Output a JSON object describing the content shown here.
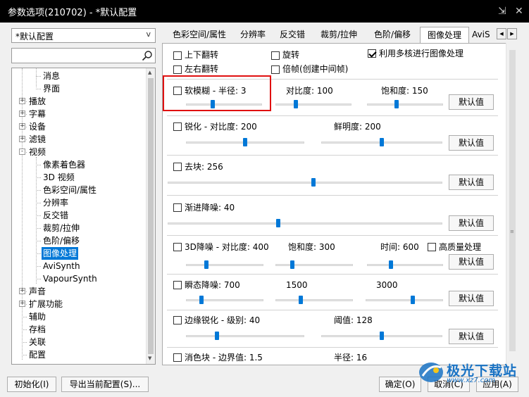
{
  "window": {
    "title": "参数选项(210702) - *默认配置",
    "pin_icon": "pin-icon",
    "close_icon": "close-icon"
  },
  "sidebar": {
    "profile_combo": "*默认配置",
    "search": {
      "value": "",
      "placeholder": ""
    },
    "tree_items": [
      {
        "label": "消息",
        "level": 2
      },
      {
        "label": "界面",
        "level": 2
      },
      {
        "label": "播放",
        "level": 1,
        "expander": "+"
      },
      {
        "label": "字幕",
        "level": 1,
        "expander": "+"
      },
      {
        "label": "设备",
        "level": 1,
        "expander": "+"
      },
      {
        "label": "滤镜",
        "level": 1,
        "expander": "+"
      },
      {
        "label": "视频",
        "level": 1,
        "expander": "-"
      },
      {
        "label": "像素着色器",
        "level": 2
      },
      {
        "label": "3D 视频",
        "level": 2
      },
      {
        "label": "色彩空间/属性",
        "level": 2
      },
      {
        "label": "分辨率",
        "level": 2
      },
      {
        "label": "反交错",
        "level": 2
      },
      {
        "label": "裁剪/拉伸",
        "level": 2
      },
      {
        "label": "色阶/偏移",
        "level": 2
      },
      {
        "label": "图像处理",
        "level": 2,
        "selected": true
      },
      {
        "label": "AviSynth",
        "level": 2
      },
      {
        "label": "VapourSynth",
        "level": 2
      },
      {
        "label": "声音",
        "level": 1,
        "expander": "+"
      },
      {
        "label": "扩展功能",
        "level": 1,
        "expander": "+"
      },
      {
        "label": "辅助",
        "level": 1
      },
      {
        "label": "存档",
        "level": 1
      },
      {
        "label": "关联",
        "level": 1
      },
      {
        "label": "配置",
        "level": 1
      }
    ]
  },
  "tabs": [
    "色彩空间/属性",
    "分辨率",
    "反交错",
    "裁剪/拉伸",
    "色阶/偏移",
    "图像处理",
    "AviS"
  ],
  "active_tab": "图像处理",
  "options": {
    "flip_v": "上下翻转",
    "flip_h": "左右翻转",
    "rotate": "旋转",
    "double_frame": "倍帧(创建中间帧)",
    "multicore": "利用多核进行图像处理",
    "multicore_checked": true
  },
  "sections": {
    "soft_blur": {
      "label": "软模糊 - 半径: 3",
      "contrast": "对比度: 100",
      "saturation": "饱和度: 150",
      "default": "默认值",
      "sliders": [
        0.34,
        0.25,
        0.38
      ]
    },
    "sharpen": {
      "label": "锐化 - 对比度: 200",
      "vivid": "鲜明度: 200",
      "default": "默认值",
      "sliders": [
        0.5,
        0.5
      ]
    },
    "deblock": {
      "label": "去块: 256",
      "default": "默认值",
      "slider": 0.53
    },
    "denoise": {
      "label": "渐进降噪: 40",
      "default": "默认值",
      "slider": 0.4
    },
    "denoise3d": {
      "label": "3D降噪 - 对比度: 400",
      "saturation": "饱和度: 300",
      "time": "时间: 600",
      "hq": "高质量处理",
      "default": "默认值",
      "sliders": [
        0.25,
        0.2,
        0.3
      ]
    },
    "transient": {
      "label": "瞬态降噪: 700",
      "v2": "1500",
      "v3": "3000",
      "default": "默认值",
      "sliders": [
        0.18,
        0.32,
        0.62
      ]
    },
    "edge_sharpen": {
      "label": "边缘锐化 - 级别: 40",
      "threshold": "阈值: 128",
      "default": "默认值",
      "sliders": [
        0.25,
        0.5
      ]
    },
    "dering": {
      "label": "消色块 - 边界值: 1.5",
      "radius": "半径: 16"
    }
  },
  "footer": {
    "init": "初始化(I)",
    "export": "导出当前配置(S)...",
    "ok": "确定(O)",
    "cancel": "取消(C)",
    "apply": "应用(A)"
  },
  "watermark": {
    "text": "极光下载站",
    "url": "www.xz7.com"
  },
  "colors": {
    "accent": "#0078d7",
    "highlight": "#e01010"
  }
}
